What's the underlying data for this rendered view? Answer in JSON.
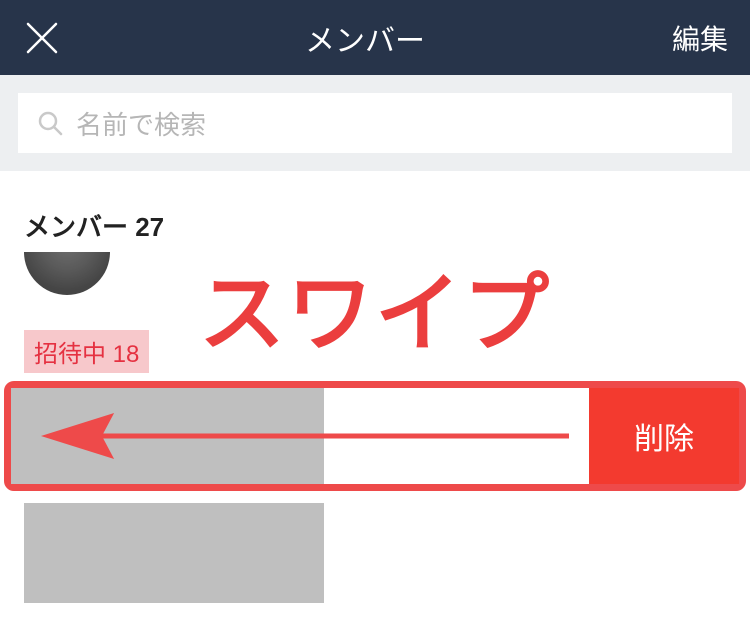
{
  "header": {
    "title": "メンバー",
    "edit_label": "編集"
  },
  "search": {
    "placeholder": "名前で検索"
  },
  "members": {
    "section_label": "メンバー 27"
  },
  "invited": {
    "badge_label": "招待中 18"
  },
  "swipe_row": {
    "delete_label": "削除"
  },
  "annotation": {
    "swipe_text": "スワイプ"
  }
}
